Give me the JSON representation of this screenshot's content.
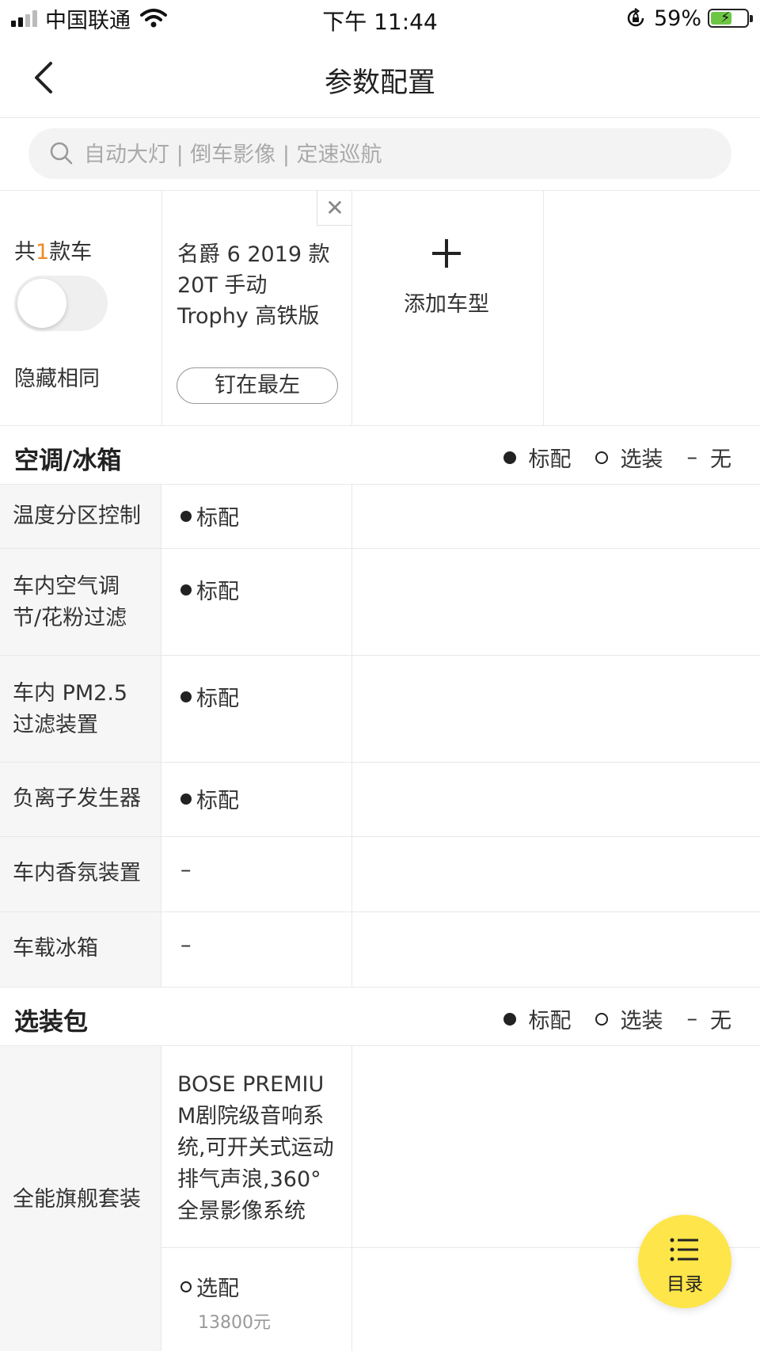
{
  "status_bar": {
    "carrier": "中国联通",
    "time": "下午 11:44",
    "battery_percent": "59%",
    "battery_level": 0.59,
    "signal_icon": "cellular-signal-icon",
    "wifi_icon": "wifi-icon",
    "rotation_lock_icon": "rotation-lock-icon",
    "battery_icon": "battery-charging-icon"
  },
  "nav": {
    "title": "参数配置",
    "back_icon": "chevron-left-icon"
  },
  "search": {
    "placeholder": "自动大灯 | 倒车影像 | 定速巡航",
    "value": "",
    "icon": "search-icon"
  },
  "header": {
    "count_prefix": "共",
    "count_number": "1",
    "count_suffix": "款车",
    "hide_same_label": "隐藏相同",
    "hide_same_on": false,
    "car_name": "名爵 6 2019 款 20T 手动 Trophy 高铁版",
    "pin_label": "钉在最左",
    "add_label": "添加车型",
    "close_icon": "close-icon",
    "add_icon": "plus-icon"
  },
  "legend": {
    "standard": "标配",
    "optional": "选装",
    "none": "无",
    "none_symbol": "–"
  },
  "sections": {
    "ac": {
      "title": "空调/冰箱",
      "rows": [
        {
          "label": "温度分区控制",
          "value": "标配"
        },
        {
          "label": "车内空气调节/花粉过滤",
          "value": "标配"
        },
        {
          "label": "车内 PM2.5 过滤装置",
          "value": "标配"
        },
        {
          "label": "负离子发生器",
          "value": "标配"
        },
        {
          "label": "车内香氛装置",
          "value": "–"
        },
        {
          "label": "车载冰箱",
          "value": "–"
        }
      ]
    },
    "pkg": {
      "title": "选装包",
      "rows": [
        {
          "label": "全能旗舰套装",
          "description": "BOSE PREMIUM剧院级音响系统,可开关式运动排气声浪,360°全景影像系统",
          "value": "选配",
          "price": "13800元"
        }
      ]
    }
  },
  "fab": {
    "label": "目录",
    "icon": "list-icon"
  },
  "colors": {
    "accent": "#f08a24",
    "fab_background": "#fde54a",
    "label_column_background": "#f6f6f6"
  }
}
